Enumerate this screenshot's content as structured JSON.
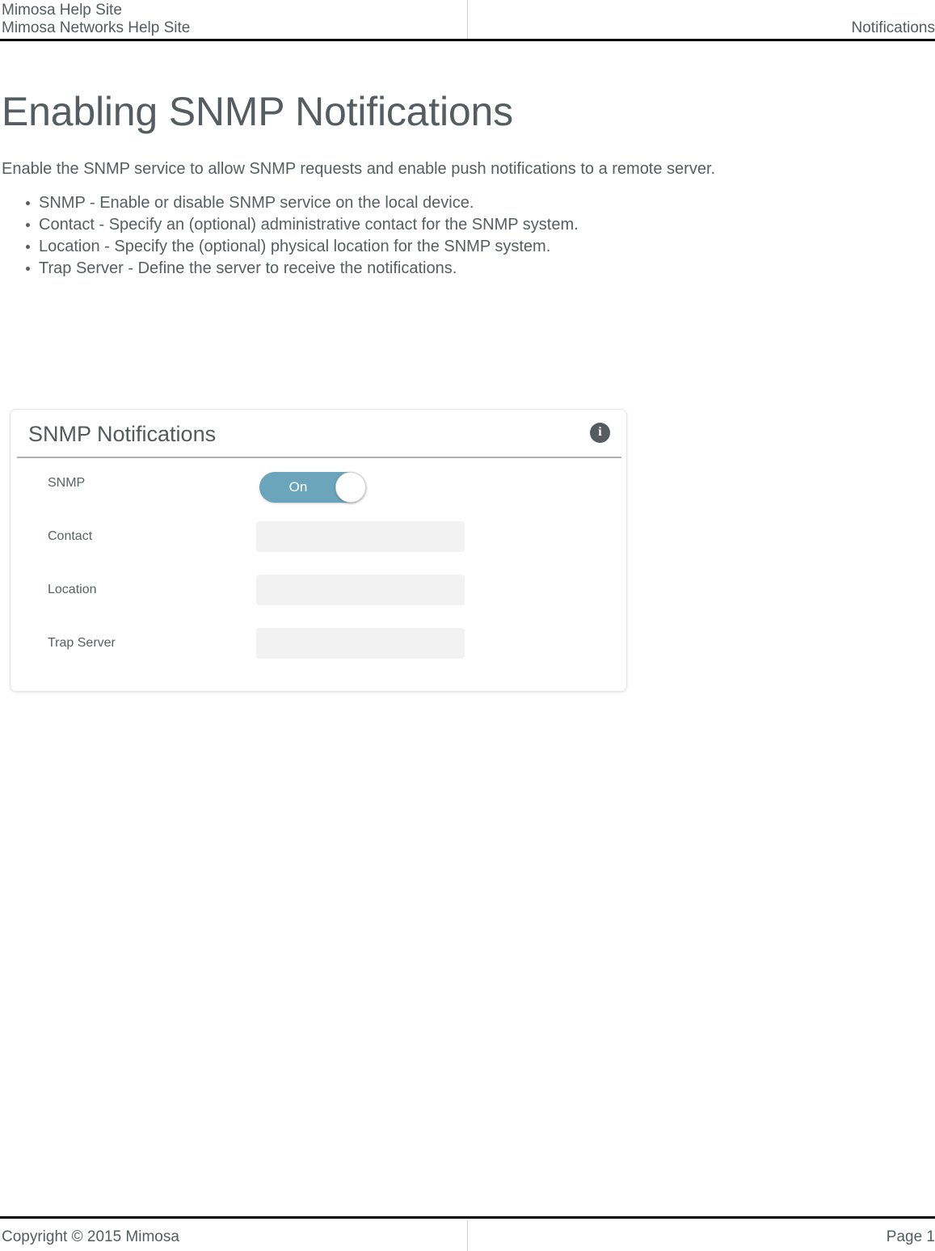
{
  "header": {
    "site_title": "Mimosa Help Site",
    "site_subtitle": "Mimosa Networks Help Site",
    "section": "Notifications"
  },
  "document": {
    "title": "Enabling SNMP Notifications",
    "intro": "Enable the SNMP service to allow SNMP requests and enable push notifications to a remote server.",
    "bullets": [
      "SNMP - Enable or disable SNMP service on the local device.",
      "Contact - Specify an (optional) administrative contact for the SNMP system.",
      "Location - Specify the (optional) physical location for the SNMP system.",
      "Trap Server - Define the server to receive the notifications."
    ]
  },
  "card": {
    "title": "SNMP Notifications",
    "info_icon": "info-icon",
    "info_glyph": "i",
    "rows": [
      {
        "label": "SNMP",
        "control": "toggle",
        "toggle_state": "On",
        "value": "",
        "placeholder": ""
      },
      {
        "label": "Contact",
        "control": "text",
        "value": "",
        "placeholder": ""
      },
      {
        "label": "Location",
        "control": "text",
        "value": "",
        "placeholder": ""
      },
      {
        "label": "Trap Server",
        "control": "text",
        "value": "",
        "placeholder": ""
      }
    ]
  },
  "footer": {
    "copyright": "Copyright © 2015 Mimosa",
    "page": "Page 1"
  },
  "colors": {
    "toggle_on": "#6aa5bb",
    "text": "#575d60",
    "title": "#565d61",
    "input_bg": "#f2f2f2",
    "rule": "#b2b2b2"
  }
}
